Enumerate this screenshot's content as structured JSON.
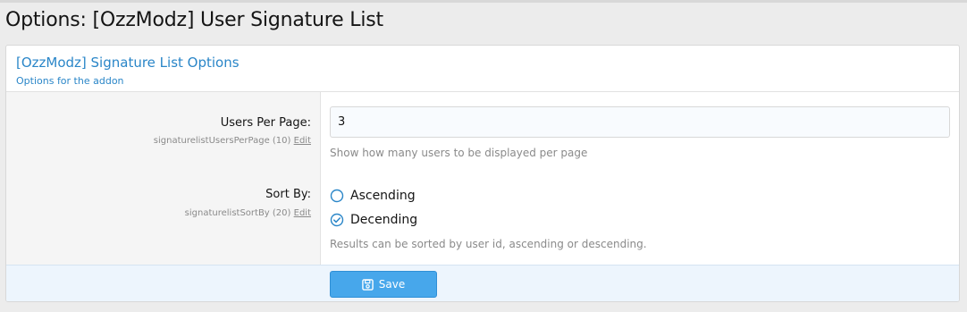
{
  "page": {
    "title": "Options: [OzzModz] User Signature List"
  },
  "block": {
    "title": "[OzzModz] Signature List Options",
    "description": "Options for the addon"
  },
  "options": [
    {
      "label": "Users Per Page:",
      "hint_id": "signaturelistUsersPerPage (10)",
      "edit_label": "Edit",
      "value": "3",
      "explain": "Show how many users to be displayed per page"
    },
    {
      "label": "Sort By:",
      "hint_id": "signaturelistSortBy (20)",
      "edit_label": "Edit",
      "choices": [
        {
          "label": "Ascending",
          "selected": false
        },
        {
          "label": "Decending",
          "selected": true
        }
      ],
      "explain": "Results can be sorted by user id, ascending or descending."
    }
  ],
  "footer": {
    "save_label": "Save"
  },
  "colors": {
    "accent": "#2a86c8",
    "button": "#47a7eb",
    "footer_bg": "#edf5fd",
    "label_bg": "#f5f5f5",
    "muted_text": "#8a8a8a"
  },
  "icons": {
    "radio_off": "radio-unchecked-icon",
    "radio_on": "radio-checked-icon",
    "save": "floppy-disk-icon"
  }
}
